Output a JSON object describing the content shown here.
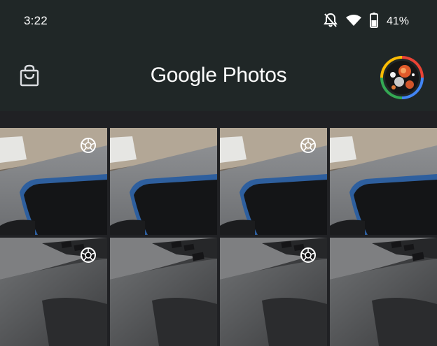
{
  "status_bar": {
    "time": "3:22",
    "icons": [
      "bell-off-icon",
      "wifi-icon",
      "battery-icon"
    ],
    "battery_percent": "41%"
  },
  "app_bar": {
    "title_brand": "Google",
    "title_product": "Photos",
    "left_icon": "shopping-bag-icon",
    "right_icon": "account-avatar"
  },
  "grid": {
    "rows": [
      [
        {
          "subject": "laptop-phone-closeup",
          "motion_icon": "motion-photo-icon",
          "has_motion": true
        },
        {
          "subject": "laptop-phone-closeup",
          "has_motion": false
        },
        {
          "subject": "laptop-phone-closeup",
          "motion_icon": "motion-photo-icon",
          "has_motion": true
        },
        {
          "subject": "laptop-phone-closeup",
          "has_motion": false
        }
      ],
      [
        {
          "subject": "laptop-keyboard-closeup",
          "motion_icon": "motion-photo-icon",
          "has_motion": true
        },
        {
          "subject": "laptop-keyboard-closeup",
          "has_motion": false
        },
        {
          "subject": "laptop-keyboard-closeup",
          "motion_icon": "motion-photo-icon",
          "has_motion": true
        },
        {
          "subject": "laptop-keyboard-closeup",
          "has_motion": false
        }
      ]
    ]
  },
  "colors": {
    "app_bar_bg": "#202727",
    "grid_bg": "#202124",
    "phone_blue": "#2b5a9a",
    "avatar_ring": [
      "#ea4335",
      "#4285f4",
      "#34a853",
      "#fbbc05"
    ]
  }
}
